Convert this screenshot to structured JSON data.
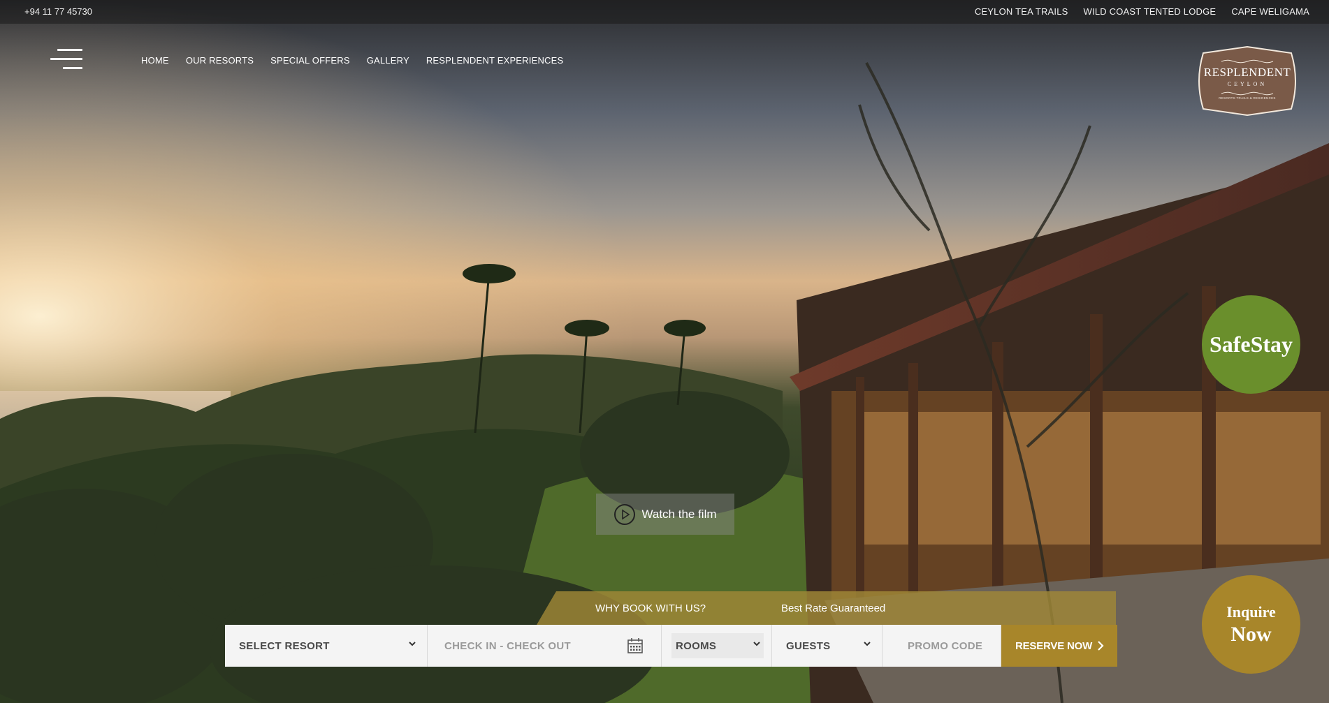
{
  "colors": {
    "accent_gold": "#a8862a",
    "safestay_green": "#6a8f2c",
    "topbar_bg": "#1f1f1f",
    "booking_field_bg": "#f4f4f4"
  },
  "topbar": {
    "phone": "+94 11 77 45730",
    "links": [
      "CEYLON TEA TRAILS",
      "WILD COAST TENTED LODGE",
      "CAPE WELIGAMA"
    ]
  },
  "nav": {
    "menu_icon": "hamburger-menu-icon",
    "items": [
      "HOME",
      "OUR RESORTS",
      "SPECIAL OFFERS",
      "GALLERY",
      "RESPLENDENT EXPERIENCES"
    ]
  },
  "logo": {
    "brand": "RESPLENDENT",
    "sub": "CEYLON",
    "tagline": "RESORTS TRAILS & RESIDENCES"
  },
  "badges": {
    "safestay": "SafeStay",
    "inquire_line1": "Inquire",
    "inquire_line2": "Now"
  },
  "hero": {
    "film_label": "Watch the film",
    "film_icon": "play-icon"
  },
  "banner": {
    "why": "WHY BOOK WITH US?",
    "best": "Best Rate Guaranteed"
  },
  "booking": {
    "resort": "SELECT RESORT",
    "dates": "CHECK IN - CHECK OUT",
    "rooms": "ROOMS",
    "guests": "GUESTS",
    "promo": "PROMO CODE",
    "reserve": "RESERVE NOW",
    "calendar_icon": "calendar-icon",
    "chevron_icon": "chevron-down-icon",
    "arrow_icon": "chevron-right-icon"
  }
}
